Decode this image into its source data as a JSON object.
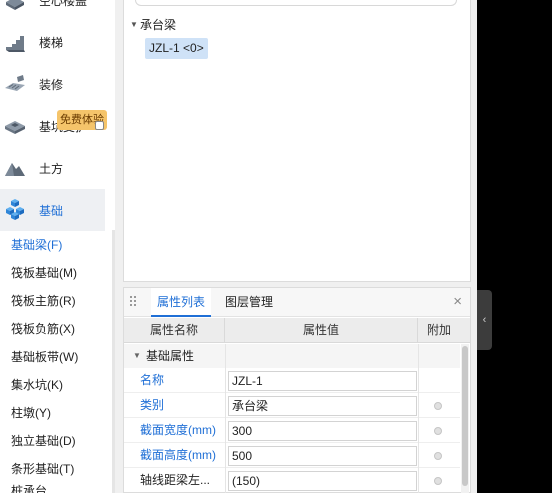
{
  "categories": [
    {
      "label": "空心楼盖",
      "icon": "hollow-slab-icon",
      "active": false
    },
    {
      "label": "楼梯",
      "icon": "stairs-icon",
      "active": false
    },
    {
      "label": "装修",
      "icon": "decoration-icon",
      "active": false
    },
    {
      "label": "基坑支护",
      "icon": "pit-support-icon",
      "active": false
    },
    {
      "label": "土方",
      "icon": "earthwork-icon",
      "active": false
    },
    {
      "label": "基础",
      "icon": "foundation-icon",
      "active": true
    }
  ],
  "badge": "免费体验",
  "sub_items": [
    {
      "label": "基础梁(F)",
      "active": true
    },
    {
      "label": "筏板基础(M)",
      "active": false
    },
    {
      "label": "筏板主筋(R)",
      "active": false
    },
    {
      "label": "筏板负筋(X)",
      "active": false
    },
    {
      "label": "基础板带(W)",
      "active": false
    },
    {
      "label": "集水坑(K)",
      "active": false
    },
    {
      "label": "柱墩(Y)",
      "active": false
    },
    {
      "label": "独立基础(D)",
      "active": false
    },
    {
      "label": "条形基础(T)",
      "active": false
    },
    {
      "label": "桩承台",
      "active": false
    }
  ],
  "tree": {
    "group": "承台梁",
    "item": "JZL-1 <0>"
  },
  "prop_panel": {
    "tabs": [
      "属性列表",
      "图层管理"
    ],
    "close": "×",
    "headers": {
      "name": "属性名称",
      "value": "属性值",
      "extra": "附加"
    },
    "group": "基础属性",
    "rows": [
      {
        "name": "名称",
        "value": "JZL-1",
        "blue": true,
        "dot": false
      },
      {
        "name": "类别",
        "value": "承台梁",
        "blue": true,
        "dot": true
      },
      {
        "name": "截面宽度(mm)",
        "value": "300",
        "blue": true,
        "dot": true
      },
      {
        "name": "截面高度(mm)",
        "value": "500",
        "blue": true,
        "dot": true
      },
      {
        "name": "轴线距梁左...",
        "value": "(150)",
        "blue": false,
        "dot": true
      }
    ]
  },
  "collapse_arrow": "‹",
  "colors": {
    "accent": "#1f6fd6",
    "badge": "#f5c46a",
    "chip": "#cfe2f7"
  }
}
